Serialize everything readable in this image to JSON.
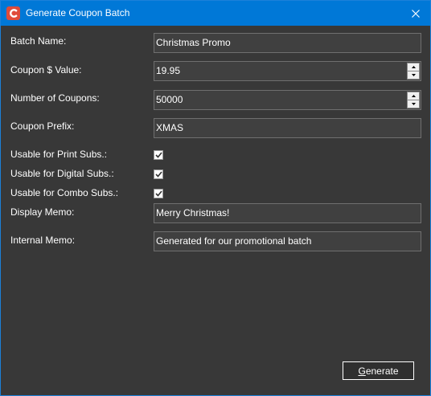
{
  "window": {
    "title": "Generate Coupon Batch",
    "accent_color": "#0078d7",
    "app_icon": "app-logo-icon",
    "close_icon": "close-icon"
  },
  "form": {
    "batch_name": {
      "label": "Batch Name:",
      "value": "Christmas Promo"
    },
    "coupon_value": {
      "label": "Coupon $ Value:",
      "value": "19.95"
    },
    "number_of_coupons": {
      "label": "Number of Coupons:",
      "value": "50000"
    },
    "coupon_prefix": {
      "label": "Coupon Prefix:",
      "value": "XMAS"
    },
    "usable_print": {
      "label": "Usable for Print Subs.:",
      "checked": true
    },
    "usable_digital": {
      "label": "Usable for Digital Subs.:",
      "checked": true
    },
    "usable_combo": {
      "label": "Usable for Combo Subs.:",
      "checked": true
    },
    "display_memo": {
      "label": "Display Memo:",
      "value": "Merry Christmas!"
    },
    "internal_memo": {
      "label": "Internal Memo:",
      "value": "Generated for our promotional batch"
    }
  },
  "actions": {
    "generate_label_first": "G",
    "generate_label_rest": "enerate"
  }
}
